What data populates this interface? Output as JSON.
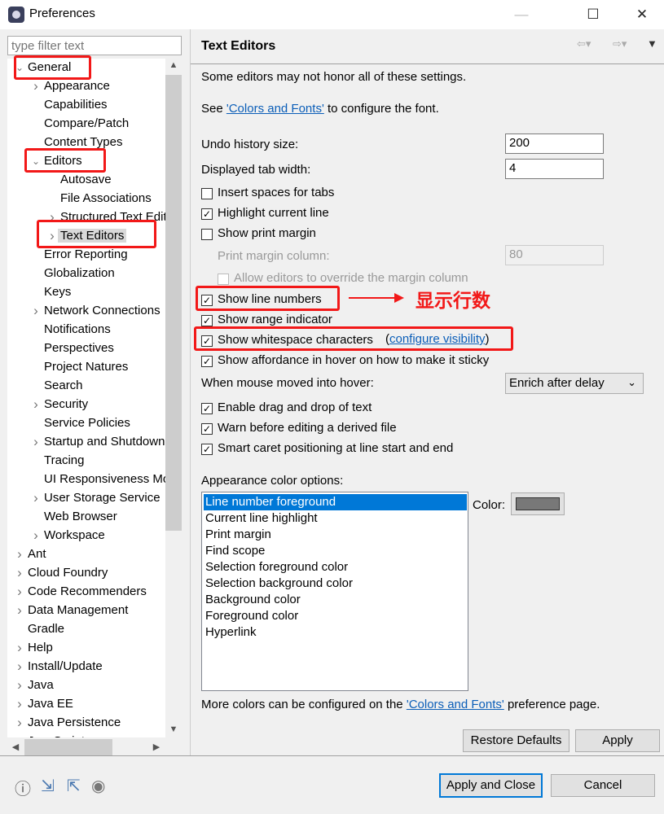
{
  "window": {
    "title": "Preferences",
    "minimize": "—",
    "maximize": "☐",
    "close": "✕"
  },
  "filter": {
    "placeholder": "type filter text"
  },
  "tree": [
    {
      "label": "General",
      "level": 0,
      "arrow": "expanded"
    },
    {
      "label": "Appearance",
      "level": 1,
      "arrow": "collapsed"
    },
    {
      "label": "Capabilities",
      "level": 1,
      "arrow": "none"
    },
    {
      "label": "Compare/Patch",
      "level": 1,
      "arrow": "none"
    },
    {
      "label": "Content Types",
      "level": 1,
      "arrow": "none"
    },
    {
      "label": "Editors",
      "level": 1,
      "arrow": "expanded"
    },
    {
      "label": "Autosave",
      "level": 2,
      "arrow": "none"
    },
    {
      "label": "File Associations",
      "level": 2,
      "arrow": "none"
    },
    {
      "label": "Structured Text Editors",
      "level": 2,
      "arrow": "collapsed"
    },
    {
      "label": "Text Editors",
      "level": 2,
      "arrow": "collapsed",
      "selected": true
    },
    {
      "label": "Error Reporting",
      "level": 1,
      "arrow": "none"
    },
    {
      "label": "Globalization",
      "level": 1,
      "arrow": "none"
    },
    {
      "label": "Keys",
      "level": 1,
      "arrow": "none"
    },
    {
      "label": "Network Connections",
      "level": 1,
      "arrow": "collapsed"
    },
    {
      "label": "Notifications",
      "level": 1,
      "arrow": "none"
    },
    {
      "label": "Perspectives",
      "level": 1,
      "arrow": "none"
    },
    {
      "label": "Project Natures",
      "level": 1,
      "arrow": "none"
    },
    {
      "label": "Search",
      "level": 1,
      "arrow": "none"
    },
    {
      "label": "Security",
      "level": 1,
      "arrow": "collapsed"
    },
    {
      "label": "Service Policies",
      "level": 1,
      "arrow": "none"
    },
    {
      "label": "Startup and Shutdown",
      "level": 1,
      "arrow": "collapsed"
    },
    {
      "label": "Tracing",
      "level": 1,
      "arrow": "none"
    },
    {
      "label": "UI Responsiveness Monitoring",
      "level": 1,
      "arrow": "none"
    },
    {
      "label": "User Storage Service",
      "level": 1,
      "arrow": "collapsed"
    },
    {
      "label": "Web Browser",
      "level": 1,
      "arrow": "none"
    },
    {
      "label": "Workspace",
      "level": 1,
      "arrow": "collapsed"
    },
    {
      "label": "Ant",
      "level": 0,
      "arrow": "collapsed"
    },
    {
      "label": "Cloud Foundry",
      "level": 0,
      "arrow": "collapsed"
    },
    {
      "label": "Code Recommenders",
      "level": 0,
      "arrow": "collapsed"
    },
    {
      "label": "Data Management",
      "level": 0,
      "arrow": "collapsed"
    },
    {
      "label": "Gradle",
      "level": 0,
      "arrow": "none"
    },
    {
      "label": "Help",
      "level": 0,
      "arrow": "collapsed"
    },
    {
      "label": "Install/Update",
      "level": 0,
      "arrow": "collapsed"
    },
    {
      "label": "Java",
      "level": 0,
      "arrow": "collapsed"
    },
    {
      "label": "Java EE",
      "level": 0,
      "arrow": "collapsed"
    },
    {
      "label": "Java Persistence",
      "level": 0,
      "arrow": "collapsed"
    },
    {
      "label": "JavaScript",
      "level": 0,
      "arrow": "collapsed"
    }
  ],
  "page": {
    "title": "Text Editors",
    "note": "Some editors may not honor all of these settings.",
    "see_prefix": "See ",
    "see_link": "'Colors and Fonts'",
    "see_suffix": " to configure the font.",
    "undo_label": "Undo history size:",
    "undo_value": "200",
    "tab_label": "Displayed tab width:",
    "tab_value": "4",
    "checks": [
      {
        "label": "Insert spaces for tabs",
        "checked": false
      },
      {
        "label": "Highlight current line",
        "checked": true
      },
      {
        "label": "Show print margin",
        "checked": false
      }
    ],
    "margin_label": "Print margin column:",
    "margin_value": "80",
    "allow_override": {
      "label": "Allow editors to override the margin column",
      "checked": false,
      "disabled": true
    },
    "checks2": [
      {
        "label": "Show line numbers",
        "checked": true
      },
      {
        "label": "Show range indicator",
        "checked": true
      },
      {
        "label": "Show whitespace characters",
        "checked": true
      },
      {
        "label": "Show affordance in hover on how to make it sticky",
        "checked": true
      }
    ],
    "visibility_open": " (",
    "visibility_link": "configure visibility",
    "visibility_close": ")",
    "hover_label": "When mouse moved into hover:",
    "hover_value": "Enrich after delay",
    "checks3": [
      {
        "label": "Enable drag and drop of text",
        "checked": true
      },
      {
        "label": "Warn before editing a derived file",
        "checked": true
      },
      {
        "label": "Smart caret positioning at line start and end",
        "checked": true
      }
    ],
    "color_options_label": "Appearance color options:",
    "color_options": [
      "Line number foreground",
      "Current line highlight",
      "Print margin",
      "Find scope",
      "Selection foreground color",
      "Selection background color",
      "Background color",
      "Foreground color",
      "Hyperlink"
    ],
    "selected_color_option": "Line number foreground",
    "color_label": "Color:",
    "color_value": "#787878",
    "more_prefix": "More colors can be configured on the ",
    "more_link": "'Colors and Fonts'",
    "more_suffix": " preference page.",
    "restore": "Restore Defaults",
    "apply": "Apply"
  },
  "footer": {
    "apply_close": "Apply and Close",
    "cancel": "Cancel",
    "icons": [
      "help-icon",
      "import-icon",
      "export-icon",
      "record-icon"
    ]
  },
  "annotation": {
    "text": "显示行数",
    "color": "#f21818"
  }
}
